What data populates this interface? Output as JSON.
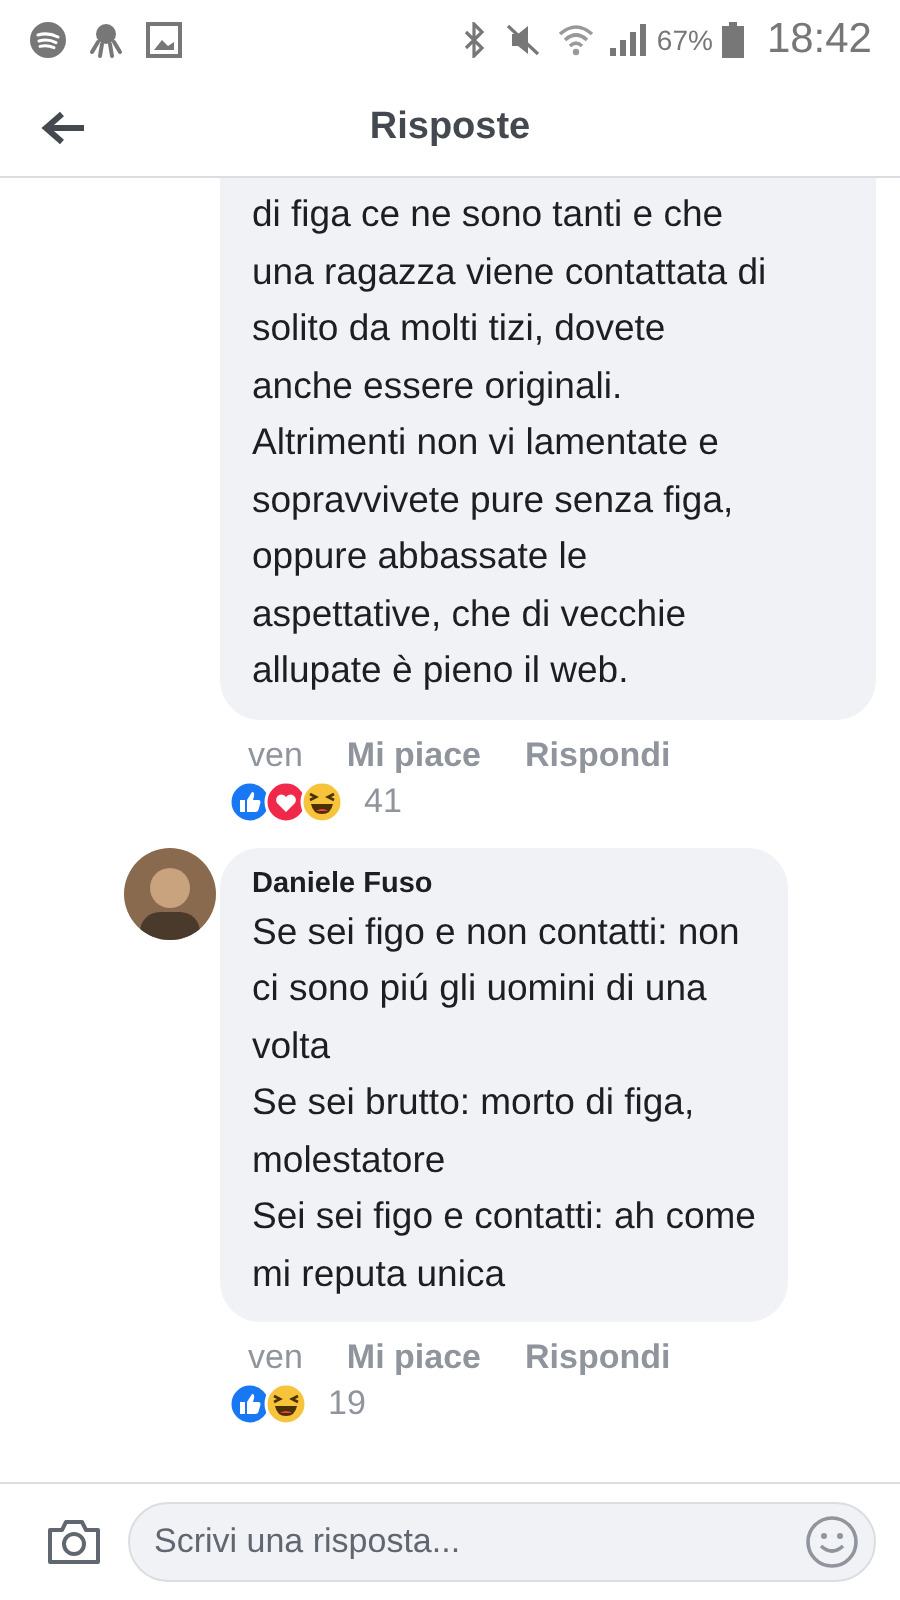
{
  "status_bar": {
    "battery_text": "67%",
    "time": "18:42"
  },
  "header": {
    "title": "Risposte"
  },
  "comments": [
    {
      "text": "di figa ce ne sono tanti e che\nuna ragazza viene contattata di\nsolito da molti tizi, dovete\nanche essere originali.\nAltrimenti non vi lamentate e\nsopravvivete pure senza figa,\noppure abbassate le\naspettative, che di vecchie\nallupate è pieno il web.",
      "time": "ven",
      "like": "Mi piace",
      "reply": "Rispondi",
      "reactions": [
        {
          "kind": "like"
        },
        {
          "kind": "love"
        },
        {
          "kind": "haha"
        }
      ],
      "count": "41"
    },
    {
      "author": "Daniele Fuso",
      "text": "Se sei figo e non contatti: non\nci sono piú gli uomini di una\nvolta\nSe sei brutto: morto di figa,\nmolestatore\nSei sei figo e contatti: ah come\nmi reputa unica",
      "time": "ven",
      "like": "Mi piace",
      "reply": "Rispondi",
      "reactions": [
        {
          "kind": "like"
        },
        {
          "kind": "haha"
        }
      ],
      "count": "19"
    }
  ],
  "composer": {
    "placeholder": "Scrivi una risposta..."
  }
}
